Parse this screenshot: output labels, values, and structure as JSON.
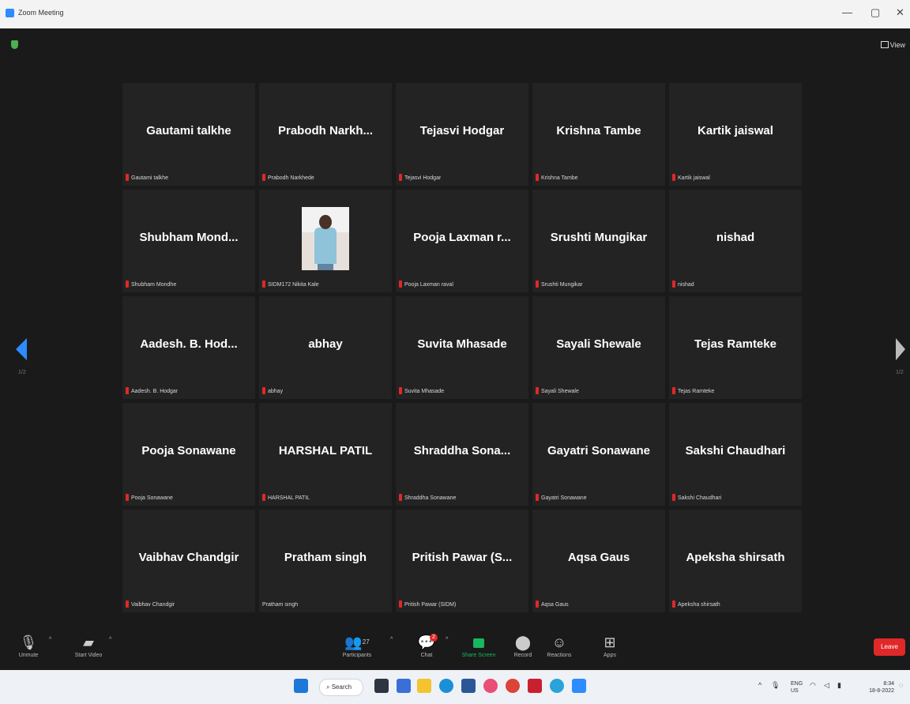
{
  "window": {
    "title": "Zoom Meeting",
    "minimize": "—",
    "maximize": "▢",
    "close": "✕"
  },
  "view_label": "View",
  "page_left": "1/2",
  "page_right": "1/2",
  "participants": [
    {
      "name": "Gautami talkhe",
      "tag": "Gautami talkhe",
      "muted": true
    },
    {
      "name": "Prabodh Narkh...",
      "tag": "Prabodh Narkhede",
      "muted": true
    },
    {
      "name": "Tejasvi Hodgar",
      "tag": "Tejasvi Hodgar",
      "muted": true
    },
    {
      "name": "Krishna Tambe",
      "tag": "Krishna Tambe",
      "muted": true
    },
    {
      "name": "Kartik jaiswal",
      "tag": "Kartik jaiswal",
      "muted": true
    },
    {
      "name": "Shubham Mond...",
      "tag": "Shubham Mondhe",
      "muted": true
    },
    {
      "name": "",
      "tag": "SIDM172 Nikita Kale",
      "muted": true,
      "video": true
    },
    {
      "name": "Pooja Laxman r...",
      "tag": "Pooja Laxman raval",
      "muted": true
    },
    {
      "name": "Srushti Mungikar",
      "tag": "Srushti Mungikar",
      "muted": true
    },
    {
      "name": "nishad",
      "tag": "nishad",
      "muted": true
    },
    {
      "name": "Aadesh. B. Hod...",
      "tag": "Aadesh. B. Hodgar",
      "muted": true
    },
    {
      "name": "abhay",
      "tag": "abhay",
      "muted": true
    },
    {
      "name": "Suvita Mhasade",
      "tag": "Suvita Mhasade",
      "muted": true
    },
    {
      "name": "Sayali Shewale",
      "tag": "Sayali Shewale",
      "muted": true
    },
    {
      "name": "Tejas Ramteke",
      "tag": "Tejas Ramteke",
      "muted": true
    },
    {
      "name": "Pooja Sonawane",
      "tag": "Pooja Sonawane",
      "muted": true
    },
    {
      "name": "HARSHAL PATIL",
      "tag": "HARSHAL PATIL",
      "muted": true
    },
    {
      "name": "Shraddha Sona...",
      "tag": "Shraddha Sonawane",
      "muted": true
    },
    {
      "name": "Gayatri Sonawane",
      "tag": "Gayatri Sonawane",
      "muted": true
    },
    {
      "name": "Sakshi Chaudhari",
      "tag": "Sakshi Chaudhari",
      "muted": true
    },
    {
      "name": "Vaibhav Chandgir",
      "tag": "Vaibhav Chandgir",
      "muted": true
    },
    {
      "name": "Pratham singh",
      "tag": "Pratham singh",
      "muted": false
    },
    {
      "name": "Pritish Pawar (S...",
      "tag": "Pritish Pawar (SIDM)",
      "muted": true
    },
    {
      "name": "Aqsa Gaus",
      "tag": "Aqsa Gaus",
      "muted": true
    },
    {
      "name": "Apeksha shirsath",
      "tag": "Apeksha shirsath",
      "muted": true
    }
  ],
  "toolbar": {
    "unmute": "Unmute",
    "start_video": "Start Video",
    "participants": "Participants",
    "participants_count": "27",
    "chat": "Chat",
    "chat_badge": "2",
    "share_screen": "Share Screen",
    "record": "Record",
    "reactions": "Reactions",
    "apps": "Apps",
    "leave": "Leave"
  },
  "taskbar": {
    "search": "Search",
    "lang": "ENG",
    "region": "US",
    "time": "8:34",
    "date": "18-8-2022"
  },
  "colors": {
    "accent": "#2d8cff",
    "mute": "#e02828",
    "share": "#17b85e",
    "leave": "#e02828"
  }
}
